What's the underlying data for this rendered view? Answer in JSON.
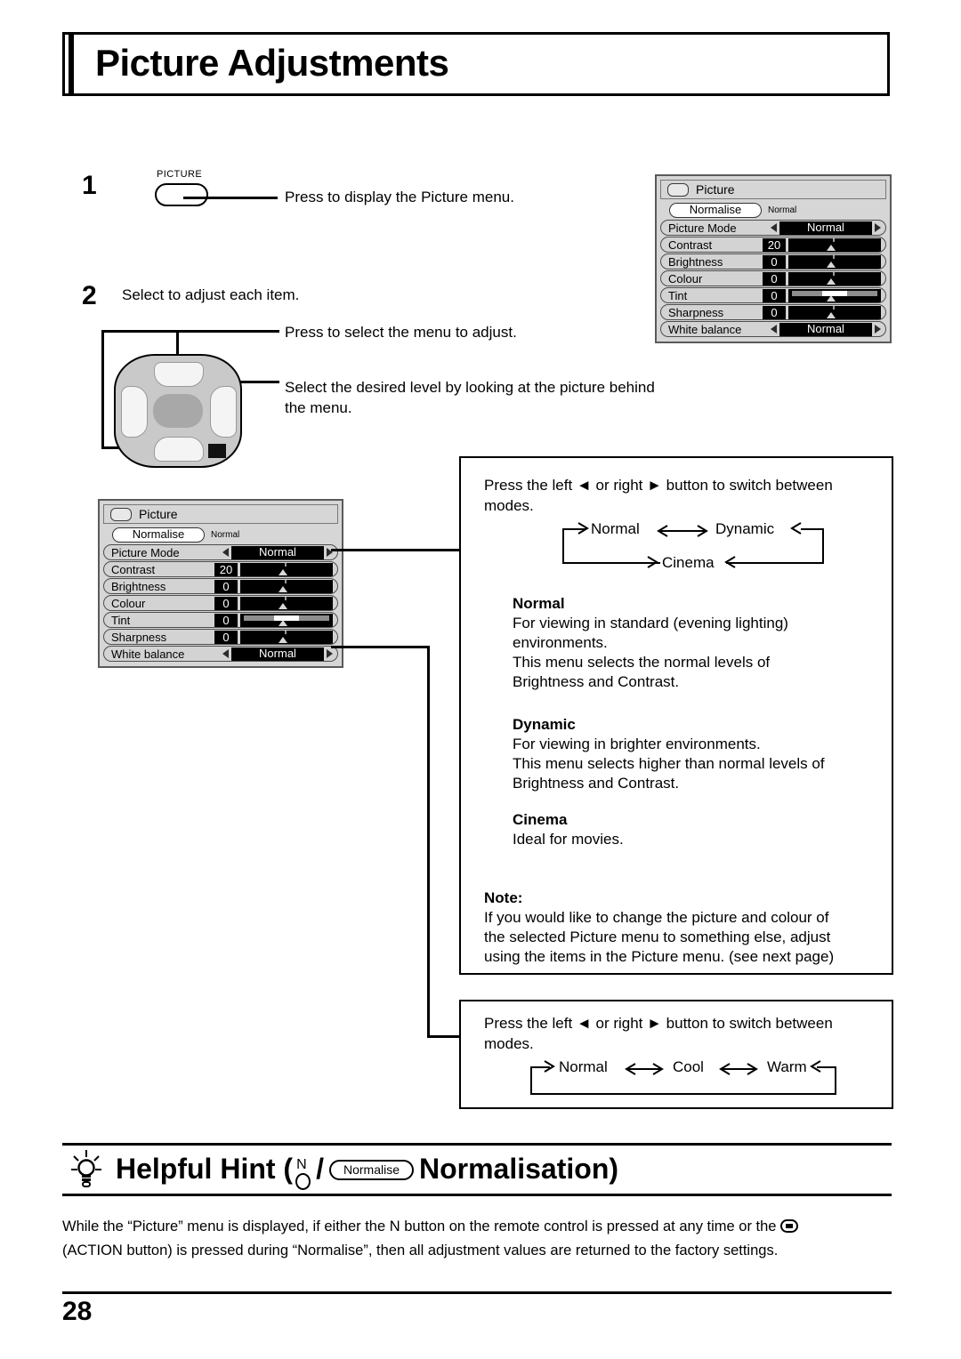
{
  "page": {
    "title": "Picture Adjustments",
    "number": "28"
  },
  "steps": [
    {
      "num": "1",
      "button_label": "PICTURE",
      "text": "Press to display the Picture menu."
    },
    {
      "num": "2",
      "text": "Select to adjust each item.",
      "callouts": [
        "Press to select the menu to adjust.",
        "Select the desired level by looking at the picture behind the menu."
      ]
    }
  ],
  "osd_menu": {
    "title": "Picture",
    "normalise_label": "Normalise",
    "normalise_state": "Normal",
    "rows": [
      {
        "label": "Picture  Mode",
        "kind": "mode",
        "value": "Normal"
      },
      {
        "label": "Contrast",
        "kind": "slider",
        "value": "20"
      },
      {
        "label": "Brightness",
        "kind": "slider",
        "value": "0"
      },
      {
        "label": "Colour",
        "kind": "slider",
        "value": "0"
      },
      {
        "label": "Tint",
        "kind": "slider-center",
        "value": "0"
      },
      {
        "label": "Sharpness",
        "kind": "slider",
        "value": "0"
      },
      {
        "label": "White balance",
        "kind": "mode",
        "value": "Normal"
      }
    ]
  },
  "picture_mode_box": {
    "intro": "Press the left ◄ or right ► button to switch between modes.",
    "cycle": [
      "Normal",
      "Dynamic",
      "Cinema"
    ],
    "descriptions": [
      {
        "heading": "Normal",
        "lines": [
          "For viewing in standard (evening lighting)",
          "environments.",
          "This menu selects the normal levels of",
          "Brightness and Contrast."
        ]
      },
      {
        "heading": "Dynamic",
        "lines": [
          "For viewing in brighter environments.",
          "This menu selects higher than normal levels of",
          "Brightness and Contrast."
        ]
      },
      {
        "heading": "Cinema",
        "lines": [
          "Ideal for movies."
        ]
      }
    ],
    "note_heading": "Note:",
    "note_lines": [
      "If you would like to change the picture and colour of",
      "the selected Picture menu to something else, adjust",
      "using the items in the Picture menu. (see next page)"
    ]
  },
  "white_balance_box": {
    "intro": "Press the left ◄ or right ► button to switch between modes.",
    "cycle": [
      "Normal",
      "Cool",
      "Warm"
    ]
  },
  "helpful_hint": {
    "title_prefix": "Helpful Hint (",
    "n_letter": "N",
    "slash": "/",
    "normalise_pill": "Normalise",
    "title_suffix": "Normalisation)",
    "body_line_1_a": "While the “Picture” menu is displayed, if either the N button on the remote control is pressed at any time or the ",
    "body_line_1_b": "",
    "body_line_2": "(ACTION button) is pressed during “Normalise”, then all adjustment values are returned to the factory settings."
  }
}
